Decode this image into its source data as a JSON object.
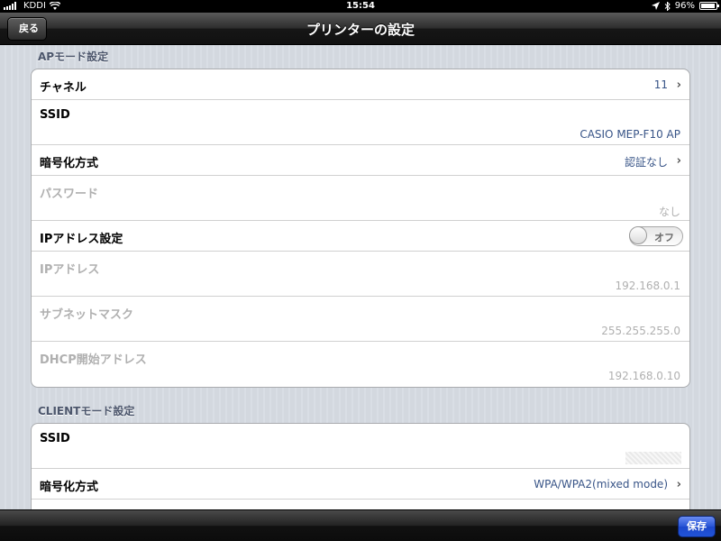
{
  "status_bar": {
    "carrier": "KDDI",
    "time": "15:54",
    "battery": "96%",
    "battery_level": 0.96
  },
  "nav": {
    "back_label": "戻る",
    "title": "プリンターの設定"
  },
  "ap_section": {
    "header": "APモード設定",
    "channel": {
      "label": "チャネル",
      "value": "11"
    },
    "ssid": {
      "label": "SSID",
      "value": "CASIO MEP-F10 AP"
    },
    "encryption": {
      "label": "暗号化方式",
      "value": "認証なし"
    },
    "password": {
      "label": "パスワード",
      "value": "なし"
    },
    "ip_setting": {
      "label": "IPアドレス設定",
      "toggle_label": "オフ",
      "on": false
    },
    "ip_address": {
      "label": "IPアドレス",
      "value": "192.168.0.1"
    },
    "subnet": {
      "label": "サブネットマスク",
      "value": "255.255.255.0"
    },
    "dhcp": {
      "label": "DHCP開始アドレス",
      "value": "192.168.0.10"
    }
  },
  "client_section": {
    "header": "CLIENTモード設定",
    "ssid": {
      "label": "SSID"
    },
    "encryption": {
      "label": "暗号化方式",
      "value": "WPA/WPA2(mixed mode)"
    }
  },
  "toolbar": {
    "save_label": "保存"
  },
  "colors": {
    "accent": "#385487",
    "disabled": "#b0b0b0",
    "save_button": "#2855d6"
  }
}
